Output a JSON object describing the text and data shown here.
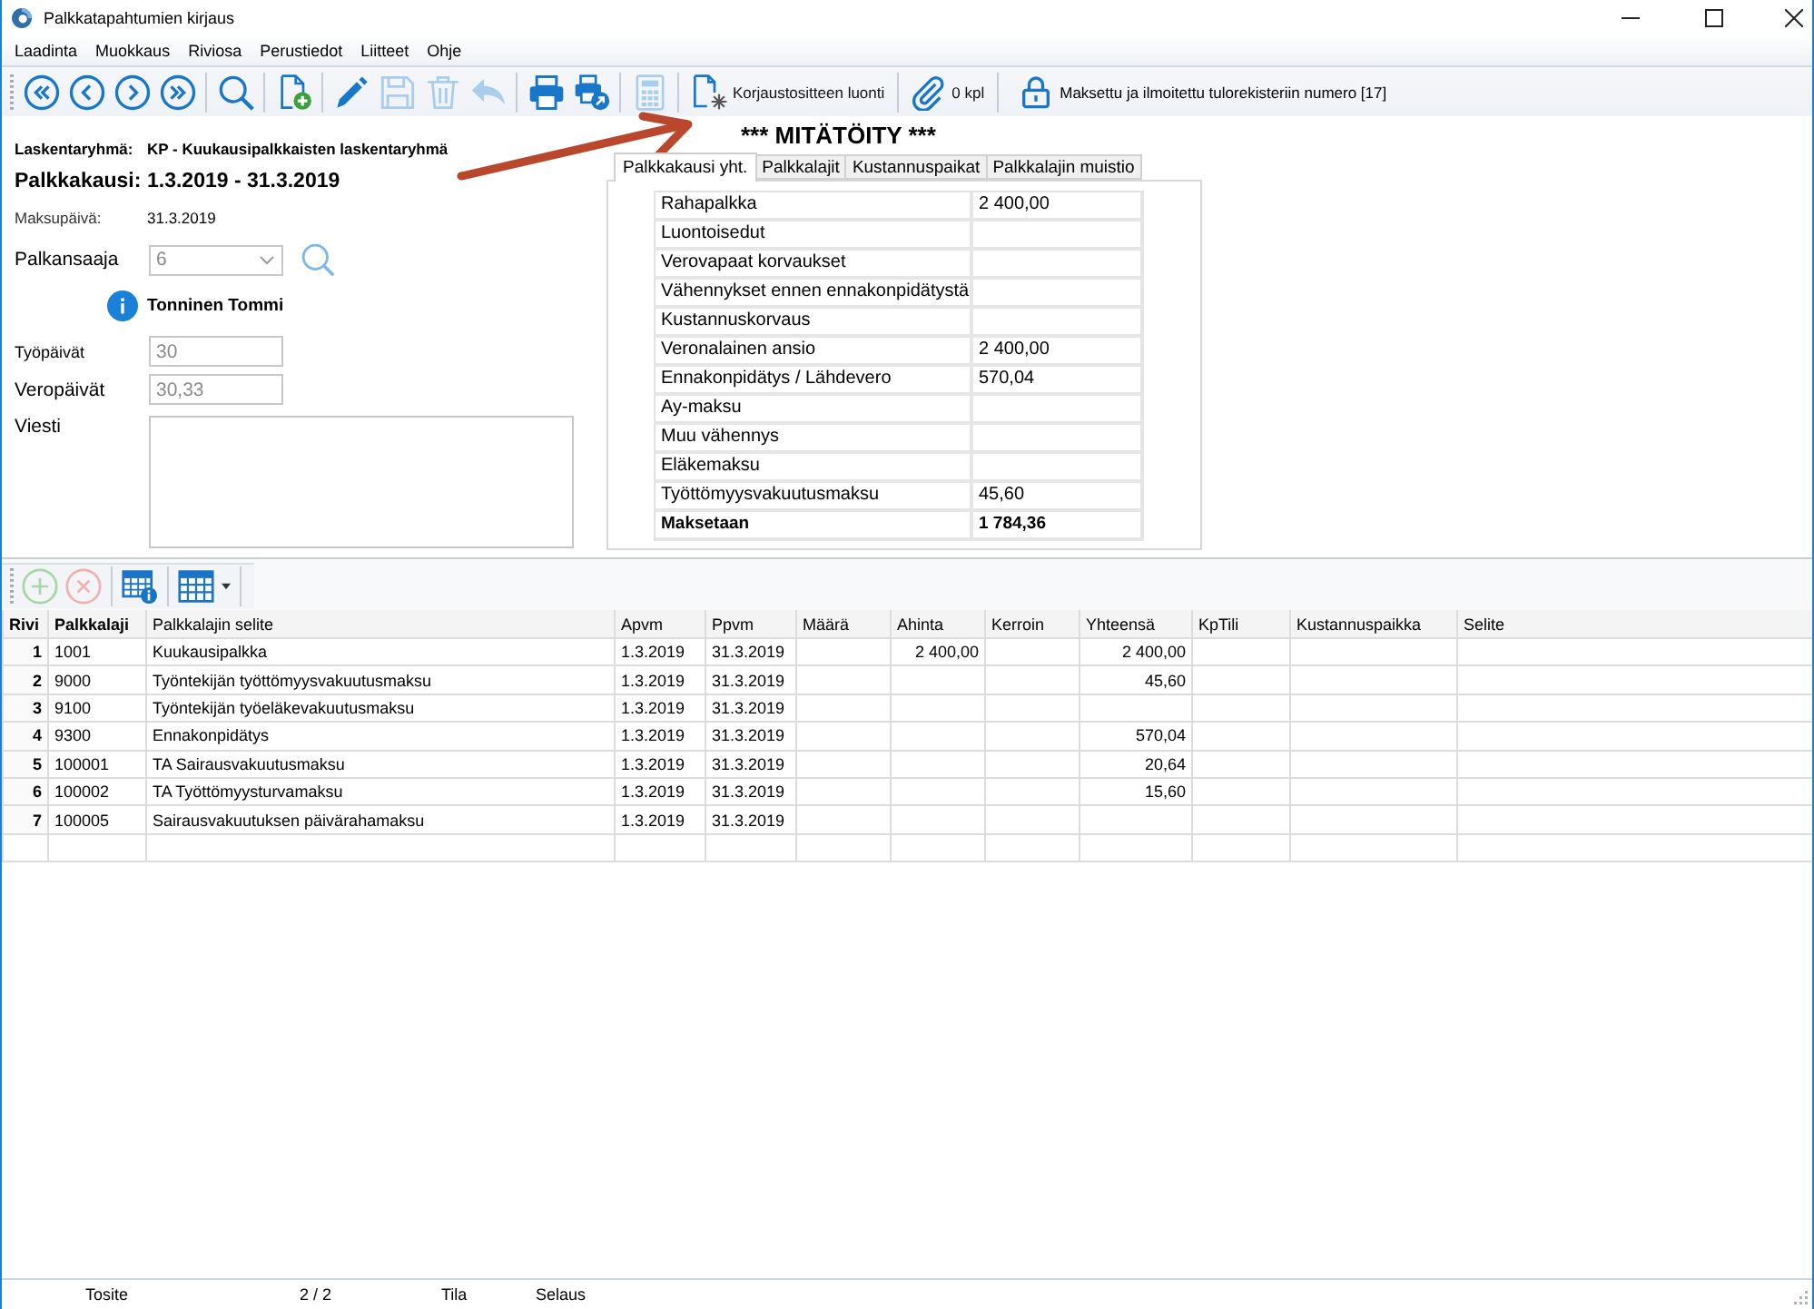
{
  "window": {
    "title": "Palkkatapahtumien kirjaus"
  },
  "menu": [
    "Laadinta",
    "Muokkaus",
    "Riviosa",
    "Perustiedot",
    "Liitteet",
    "Ohje"
  ],
  "toolbar": {
    "groups": [
      [
        {
          "disabled": false
        },
        {
          "disabled": false
        },
        {
          "disabled": false
        },
        {
          "disabled": false
        }
      ],
      [
        {
          "disabled": false
        }
      ],
      [
        {
          "disabled": false
        }
      ],
      [
        {
          "disabled": false
        },
        {
          "disabled": true
        },
        {
          "disabled": true
        },
        {
          "disabled": true
        }
      ],
      [
        {
          "disabled": false
        },
        {
          "disabled": false
        }
      ],
      [
        {
          "disabled": true
        }
      ],
      [
        {
          "disabled": false,
          "label": "Korjaustositteen luonti"
        }
      ],
      [
        {
          "disabled": false,
          "label": "0 kpl"
        }
      ]
    ],
    "status": "Maksettu ja ilmoitettu tulorekisteriin numero [17]"
  },
  "header": {
    "calc_group_label": "Laskentaryhmä:",
    "calc_group": "KP - Kuukausipalkkaisten laskentaryhmä",
    "period_label": "Palkkakausi:",
    "period": "1.3.2019 - 31.3.2019",
    "pay_date_label": "Maksupäivä:",
    "pay_date": "31.3.2019"
  },
  "payee": {
    "label": "Palkansaaja",
    "value": "6",
    "disabled": true,
    "name": "Tonninen Tommi"
  },
  "day_fields": [
    {
      "label": "Työpäivät",
      "value": "30",
      "disabled": true
    },
    {
      "label": "Veropäivät",
      "value": "30,33",
      "disabled": true
    }
  ],
  "message": {
    "label": "Viesti"
  },
  "voided_title": "*** MITÄTÖITY ***",
  "tabs": [
    {
      "label": "Palkkakausi yht.",
      "selected": true
    },
    {
      "label": "Palkkalajit",
      "selected": false
    },
    {
      "label": "Kustannuspaikat",
      "selected": false
    },
    {
      "label": "Palkkalajin muistio",
      "selected": false
    }
  ],
  "summary": [
    {
      "kind": "row",
      "label": "Rahapalkka",
      "value": "2 400,00"
    },
    {
      "kind": "row",
      "label": "Luontoisedut"
    },
    {
      "kind": "row",
      "label": "Verovapaat korvaukset"
    },
    {
      "kind": "row",
      "label": "Vähennykset ennen ennakonpidätystä"
    },
    {
      "kind": "row",
      "label": "Kustannuskorvaus"
    },
    {
      "kind": "row",
      "label": "Veronalainen ansio",
      "value": "2 400,00"
    },
    {
      "kind": "row",
      "label": "Ennakonpidätys / Lähdevero",
      "value": "570,04"
    },
    {
      "kind": "row",
      "label": "Ay-maksu"
    },
    {
      "kind": "row",
      "label": "Muu vähennys"
    },
    {
      "kind": "row",
      "label": "Eläkemaksu"
    },
    {
      "kind": "row",
      "label": "Työttömyysvakuutusmaksu",
      "value": "45,60"
    },
    {
      "kind": "total",
      "label": "Maksetaan",
      "value": "1 784,36"
    }
  ],
  "grid_toolbar": [
    {
      "disabled": true
    },
    {
      "disabled": true
    },
    {
      "disabled": false
    },
    {
      "disabled": false
    }
  ],
  "table": {
    "columns": [
      "Rivi",
      "Palkkalaji",
      "Palkkalajin selite",
      "Apvm",
      "Ppvm",
      "Määrä",
      "Ahinta",
      "Kerroin",
      "Yhteensä",
      "KpTili",
      "Kustannuspaikka",
      "Selite"
    ],
    "rows": [
      [
        "1",
        "1001",
        "Kuukausipalkka",
        "1.3.2019",
        "31.3.2019",
        null,
        "2 400,00",
        null,
        "2 400,00",
        null,
        null,
        null
      ],
      [
        "2",
        "9000",
        "Työntekijän työttömyysvakuutusmaksu",
        "1.3.2019",
        "31.3.2019",
        null,
        null,
        null,
        "45,60",
        null,
        null,
        null
      ],
      [
        "3",
        "9100",
        "Työntekijän työeläkevakuutusmaksu",
        "1.3.2019",
        "31.3.2019",
        null,
        null,
        null,
        null,
        null,
        null,
        null
      ],
      [
        "4",
        "9300",
        "Ennakonpidätys",
        "1.3.2019",
        "31.3.2019",
        null,
        null,
        null,
        "570,04",
        null,
        null,
        null
      ],
      [
        "5",
        "100001",
        "TA Sairausvakuutusmaksu",
        "1.3.2019",
        "31.3.2019",
        null,
        null,
        null,
        "20,64",
        null,
        null,
        null
      ],
      [
        "6",
        "100002",
        "TA Työttömyysturvamaksu",
        "1.3.2019",
        "31.3.2019",
        null,
        null,
        null,
        "15,60",
        null,
        null,
        null
      ],
      [
        "7",
        "100005",
        "Sairausvakuutuksen päivärahamaksu",
        "1.3.2019",
        "31.3.2019",
        null,
        null,
        null,
        null,
        null,
        null,
        null
      ]
    ]
  },
  "status_bar": [
    "Tosite",
    "2 / 2",
    "Tila",
    "Selaus"
  ]
}
